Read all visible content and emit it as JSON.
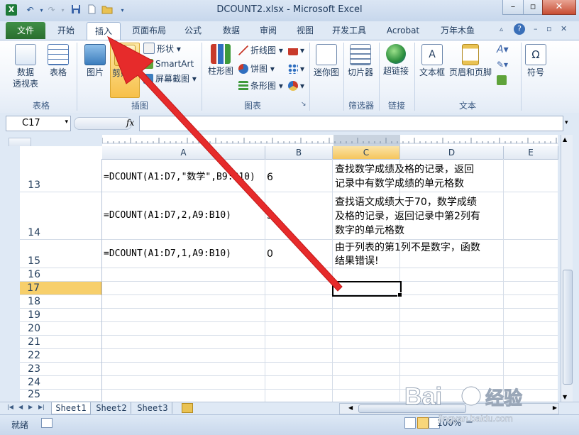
{
  "window": {
    "title": "DCOUNT2.xlsx - Microsoft Excel",
    "app_icon": "X",
    "controls": {
      "minimize": "–",
      "restore": "▫",
      "close": "✕"
    }
  },
  "tabs": [
    {
      "label": "文件"
    },
    {
      "label": "开始"
    },
    {
      "label": "插入"
    },
    {
      "label": "页面布局"
    },
    {
      "label": "公式"
    },
    {
      "label": "数据"
    },
    {
      "label": "审阅"
    },
    {
      "label": "视图"
    },
    {
      "label": "开发工具"
    },
    {
      "label": "Acrobat"
    },
    {
      "label": "万年木鱼"
    }
  ],
  "ribbon": {
    "groups": {
      "table": "表格",
      "illustrations": "插图",
      "charts": "图表",
      "filter": "筛选器",
      "links": "链接",
      "text": "文本"
    },
    "buttons": {
      "pivot": "数据\n透视表",
      "table": "表格",
      "picture": "图片",
      "clipart": "剪贴画",
      "shapes": "形状",
      "smartart": "SmartArt",
      "screenshot": "屏幕截图",
      "column_chart": "柱形图",
      "line_chart": "折线图",
      "pie_chart": "饼图",
      "bar_chart": "条形图",
      "sparkline": "迷你图",
      "slicer": "切片器",
      "hyperlink": "超链接",
      "textbox": "文本框",
      "header_footer": "页眉和页脚",
      "symbol": "符号"
    }
  },
  "formula_bar": {
    "name_box": "C17",
    "fx": "fx",
    "value": ""
  },
  "columns": [
    "A",
    "B",
    "C",
    "D",
    "E"
  ],
  "rows": [
    {
      "num": "13",
      "a": "=DCOUNT(A1:D7,\"数学\",B9:B10)",
      "b": "6",
      "c": [
        "查找数学成绩及格的记录，返回",
        "记录中有数学成绩的单元格数"
      ]
    },
    {
      "num": "14",
      "a": "=DCOUNT(A1:D7,2,A9:B10)",
      "b": "5",
      "c": [
        "查找语文成绩大于70，数学成绩",
        "及格的记录，返回记录中第2列有",
        "数字的单元格数"
      ]
    },
    {
      "num": "15",
      "a": "=DCOUNT(A1:D7,1,A9:B10)",
      "b": "0",
      "c": [
        "由于列表的第1列不是数字，函数",
        "结果错误!"
      ]
    },
    {
      "num": "16"
    },
    {
      "num": "17"
    },
    {
      "num": "18"
    },
    {
      "num": "19"
    },
    {
      "num": "20"
    },
    {
      "num": "21"
    },
    {
      "num": "22"
    },
    {
      "num": "23"
    },
    {
      "num": "24"
    },
    {
      "num": "25"
    }
  ],
  "sheets": [
    "Sheet1",
    "Sheet2",
    "Sheet3"
  ],
  "status": {
    "ready": "就绪",
    "zoom": "100%",
    "zoom_minus": "−"
  },
  "watermark": {
    "text": "Bai",
    "suffix": "经验",
    "url": "jingyan.baidu.com"
  }
}
